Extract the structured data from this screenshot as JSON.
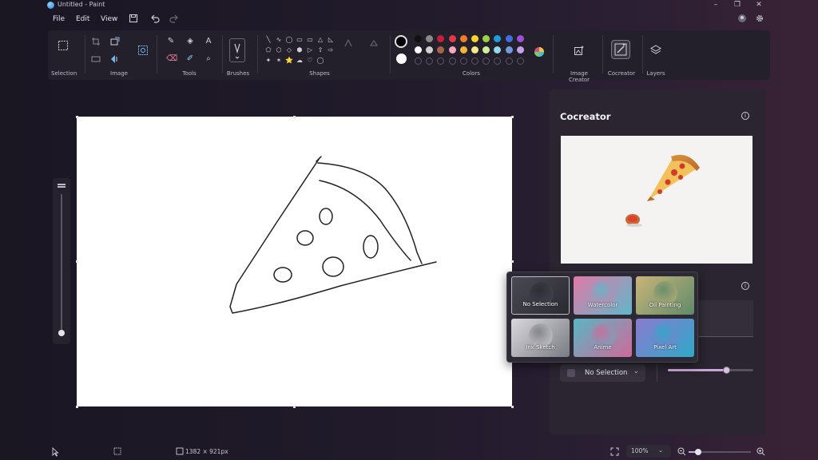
{
  "window": {
    "title": "Untitled - Paint",
    "minimize_glyph": "–",
    "maximize_glyph": "❐",
    "close_glyph": "✕"
  },
  "menu": {
    "file": "File",
    "edit": "Edit",
    "view": "View"
  },
  "ribbon": {
    "groups": {
      "selection": "Selection",
      "image": "Image",
      "tools": "Tools",
      "brushes": "Brushes",
      "shapes": "Shapes",
      "colors": "Colors",
      "image_creator": "Image Creator",
      "cocreator": "Cocreator",
      "layers": "Layers"
    },
    "tool_glyphs": {
      "pencil": "✎",
      "fill": "◈",
      "text": "A",
      "eraser": "⌫",
      "color_picker": "✐",
      "magnifier": "⌕"
    },
    "shape_glyphs": [
      "╲",
      "∿",
      "◯",
      "▭",
      "▭",
      "△",
      "◺",
      "⬠",
      "⬡",
      "◇",
      "⬢",
      "▷",
      "⇧",
      "⇨",
      "✦",
      "✶",
      "⭐",
      "☁",
      "♡",
      "◯"
    ],
    "palette_row1": [
      "#111111",
      "#8a8a8a",
      "#c4203a",
      "#e2394a",
      "#f07b2a",
      "#f5d327",
      "#9ad24a",
      "#1e9cdb",
      "#3f6ee0",
      "#9c4fd8"
    ],
    "palette_row2": [
      "#ffffff",
      "#d0d0d0",
      "#a86446",
      "#f6a7c2",
      "#f6b33a",
      "#f6e98a",
      "#d2ee9a",
      "#92d9ef",
      "#6f9be0",
      "#c3a1e6"
    ],
    "primary_color": "#000000",
    "secondary_color": "#ffffff"
  },
  "canvas": {
    "drawing": "pizza slice sketch"
  },
  "cocreator": {
    "title": "Cocreator",
    "info_glyph": "i",
    "style_options": [
      {
        "label": "No Selection",
        "colors": [
          "#4a4a55",
          "#2a2a31"
        ]
      },
      {
        "label": "Watercolor",
        "colors": [
          "#e07aa8",
          "#5fb7c9"
        ]
      },
      {
        "label": "Oil Painting",
        "colors": [
          "#c9b57a",
          "#5f8a6a"
        ]
      },
      {
        "label": "Ink Sketch",
        "colors": [
          "#d9d9dd",
          "#7a7a82"
        ]
      },
      {
        "label": "Anime",
        "colors": [
          "#58b6c4",
          "#d06a9a"
        ]
      },
      {
        "label": "Pixel Art",
        "colors": [
          "#8a7ad0",
          "#2fa9c9"
        ]
      }
    ],
    "selected_style": "No Selection",
    "dropdown_chevron": "⌄",
    "creativity_level": 0.68
  },
  "status": {
    "canvas_size": "1382 × 921px",
    "zoom": "100%",
    "zoom_slider_level": 0.15
  }
}
